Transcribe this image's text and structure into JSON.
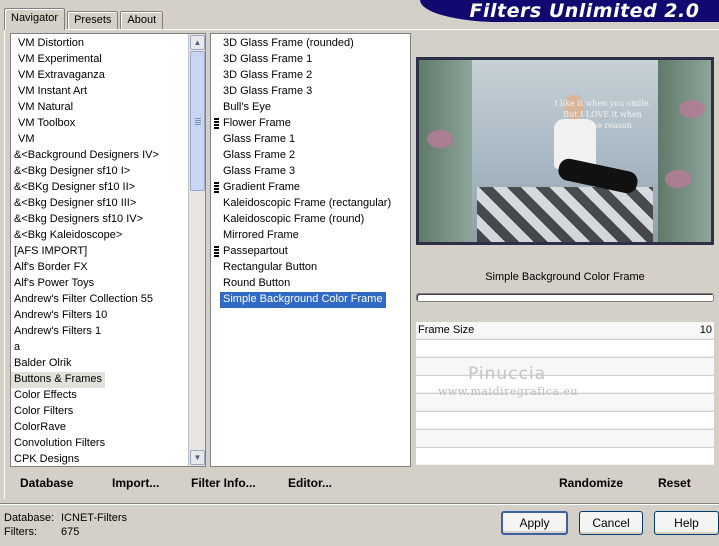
{
  "tabs": [
    "Navigator",
    "Presets",
    "About"
  ],
  "banner_title": "Filters Unlimited 2.0",
  "categories": [
    "VM Distortion",
    "VM Experimental",
    "VM Extravaganza",
    "VM Instant Art",
    "VM Natural",
    "VM Toolbox",
    "VM",
    "&<Background Designers IV>",
    "&<Bkg Designer sf10 I>",
    "&<BKg Designer sf10 II>",
    "&<Bkg Designer sf10 III>",
    "&<Bkg Designers sf10 IV>",
    "&<Bkg Kaleidoscope>",
    "[AFS IMPORT]",
    "Alf's Border FX",
    "Alf's Power Toys",
    "Andrew's Filter Collection 55",
    "Andrew's Filters 10",
    "Andrew's Filters 1",
    "a",
    "Balder Olrik",
    "Buttons & Frames",
    "Color Effects",
    "Color Filters",
    "ColorRave",
    "Convolution Filters",
    "CPK Designs"
  ],
  "selected_category": "Buttons & Frames",
  "filters": [
    {
      "label": "3D Glass Frame (rounded)",
      "marker": false
    },
    {
      "label": "3D Glass Frame 1",
      "marker": false
    },
    {
      "label": "3D Glass Frame 2",
      "marker": false
    },
    {
      "label": "3D Glass Frame 3",
      "marker": false
    },
    {
      "label": "Bull's Eye",
      "marker": false
    },
    {
      "label": "Flower Frame",
      "marker": true
    },
    {
      "label": "Glass Frame 1",
      "marker": false
    },
    {
      "label": "Glass Frame 2",
      "marker": false
    },
    {
      "label": "Glass Frame 3",
      "marker": false
    },
    {
      "label": "Gradient Frame",
      "marker": true
    },
    {
      "label": "Kaleidoscopic Frame (rectangular)",
      "marker": false
    },
    {
      "label": "Kaleidoscopic Frame (round)",
      "marker": false
    },
    {
      "label": "Mirrored Frame",
      "marker": false
    },
    {
      "label": "Passepartout",
      "marker": true
    },
    {
      "label": "Rectangular Button",
      "marker": false
    },
    {
      "label": "Round Button",
      "marker": false
    },
    {
      "label": "Simple Background Color Frame",
      "marker": false
    }
  ],
  "selected_filter": "Simple Background Color Frame",
  "preview": {
    "text_lines": [
      "I like it when you smile.",
      "But I LOVE it when",
      "I'm the reason"
    ]
  },
  "current_filter_name": "Simple Background Color Frame",
  "params": [
    {
      "label": "Frame Size",
      "value": "10"
    }
  ],
  "watermark": {
    "name": "Pinuccia",
    "url": "www.maidiregrafica.eu"
  },
  "bottom_bar": {
    "database": "Database",
    "import": "Import...",
    "filter_info": "Filter Info...",
    "editor": "Editor...",
    "randomize": "Randomize",
    "reset": "Reset"
  },
  "status": {
    "database_label": "Database:",
    "database_value": "ICNET-Filters",
    "filters_label": "Filters:",
    "filters_value": "675"
  },
  "buttons": {
    "apply": "Apply",
    "cancel": "Cancel",
    "help": "Help"
  },
  "colors": {
    "banner": "#100a70",
    "selection": "#316ac5",
    "dialog": "#d4d0c8"
  }
}
